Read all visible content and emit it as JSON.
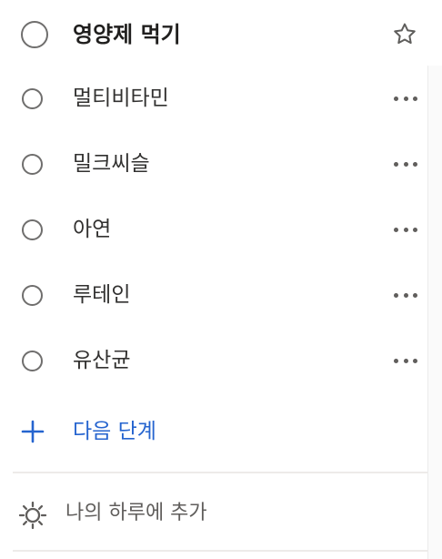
{
  "task": {
    "title": "영양제 먹기",
    "favorite_icon": "star-icon",
    "check_icon": "circle-icon"
  },
  "steps": [
    {
      "label": "멀티비타민",
      "menu_icon": "more-icon"
    },
    {
      "label": "밀크씨슬",
      "menu_icon": "more-icon"
    },
    {
      "label": "아연",
      "menu_icon": "more-icon"
    },
    {
      "label": "루테인",
      "menu_icon": "more-icon"
    },
    {
      "label": "유산균",
      "menu_icon": "more-icon"
    }
  ],
  "actions": {
    "add_step": "다음 단계",
    "add_to_my_day": "나의 하루에 추가",
    "add_step_icon": "plus-icon",
    "my_day_icon": "sun-icon"
  },
  "colors": {
    "accent": "#2564cf",
    "text_primary": "#323130",
    "text_secondary": "#605e5c",
    "circle_border": "#6f6e6d",
    "divider": "#edebe9"
  }
}
